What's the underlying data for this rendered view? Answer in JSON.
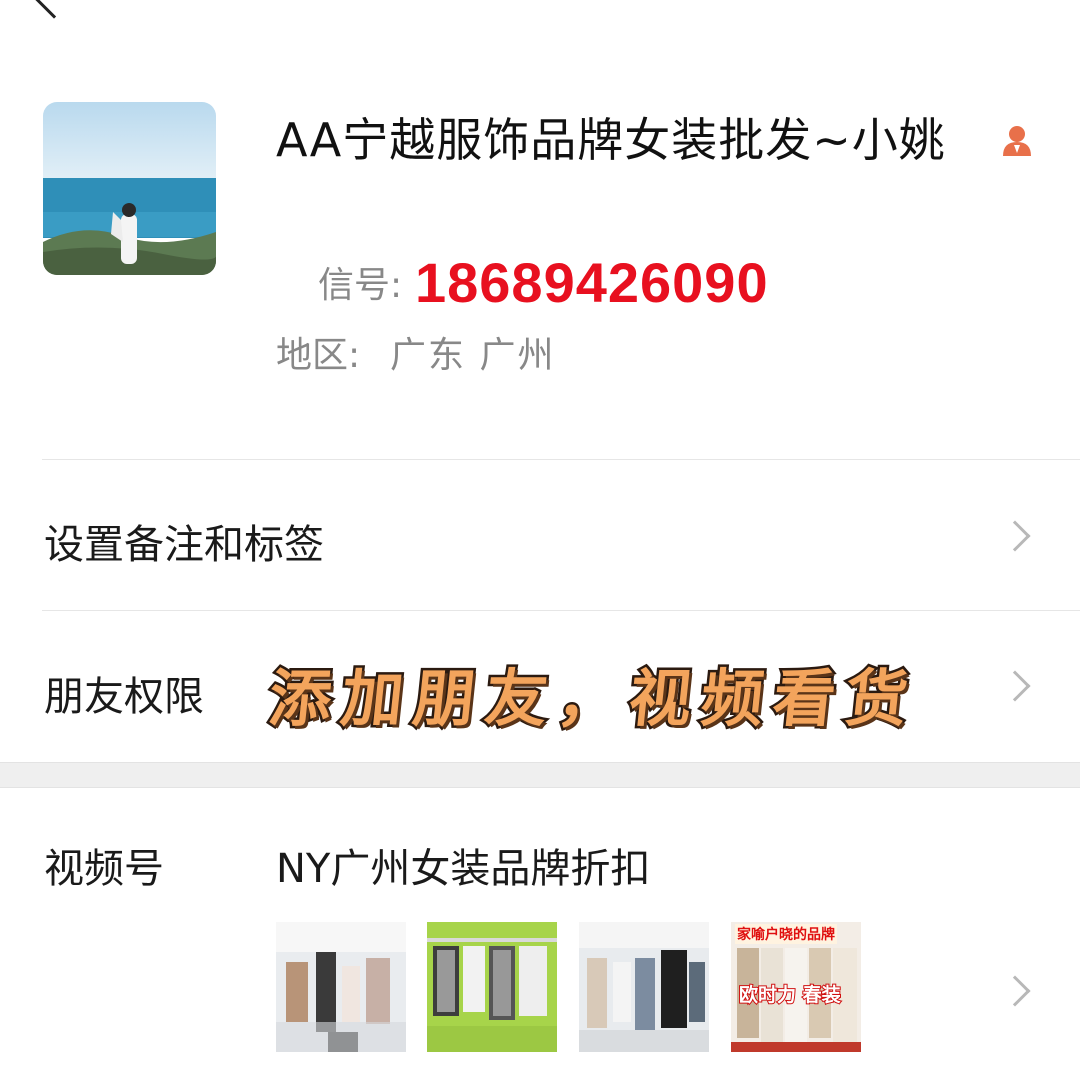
{
  "profile": {
    "name": "AA宁越服饰品牌女装批发~小姚",
    "wechat_id_label": "信号:",
    "wechat_id": "18689426090",
    "region_label": "地区:",
    "region": "广东  广州",
    "verify_icon": "person-badge-icon"
  },
  "rows": {
    "remark_label": "设置备注和标签",
    "permission_label": "朋友权限",
    "permission_promo": "添加朋友，视频看货",
    "channel_label": "视频号",
    "channel_name": "NY广州女装品牌折扣"
  },
  "thumbnails": [
    {
      "caption_top": "",
      "caption_mid": ""
    },
    {
      "caption_top": "",
      "caption_mid": ""
    },
    {
      "caption_top": "",
      "caption_mid": ""
    },
    {
      "caption_top": "家喻户晓的品牌",
      "caption_mid": "欧时力 春装"
    }
  ],
  "colors": {
    "accent_red": "#e8101f",
    "muted": "#888888",
    "icon_orange": "#e8704a"
  }
}
